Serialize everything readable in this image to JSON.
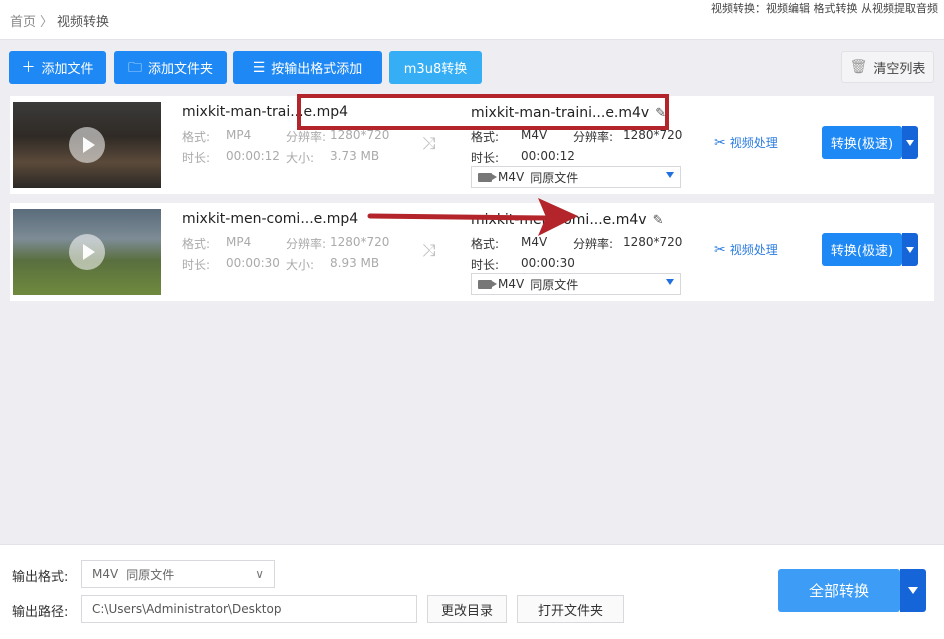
{
  "breadcrumb": {
    "home": "首页",
    "sep": "〉",
    "current": "视频转换"
  },
  "top_notice": "视频转换：视频编辑 格式转换 从视频提取音频",
  "toolbar": {
    "add_file": "添加文件",
    "add_folder": "添加文件夹",
    "add_by_format": "按输出格式添加",
    "m3u8": "m3u8转换",
    "clear_list": "清空列表"
  },
  "labels": {
    "format": "格式:",
    "resolution": "分辨率:",
    "duration": "时长:",
    "size": "大小:",
    "video_process": "视频处理",
    "convert_fast": "转换(极速)",
    "output_same_folder": "同原文件"
  },
  "files": [
    {
      "src_name": "mixkit-man-trai...e.mp4",
      "src_format": "MP4",
      "src_resolution": "1280*720",
      "src_duration": "00:00:12",
      "src_size": "3.73 MB",
      "dst_name": "mixkit-man-traini...e.m4v",
      "dst_format": "M4V",
      "dst_resolution": "1280*720",
      "dst_duration": "00:00:12",
      "dst_select": "M4V"
    },
    {
      "src_name": "mixkit-men-comi...e.mp4",
      "src_format": "MP4",
      "src_resolution": "1280*720",
      "src_duration": "00:00:30",
      "src_size": "8.93 MB",
      "dst_name": "mixkit-men-comi...e.m4v",
      "dst_format": "M4V",
      "dst_resolution": "1280*720",
      "dst_duration": "00:00:30",
      "dst_select": "M4V"
    }
  ],
  "bottom": {
    "output_format_label": "输出格式:",
    "output_format_value": "M4V",
    "output_format_folder": "同原文件",
    "output_path_label": "输出路径:",
    "output_path_value": "C:\\Users\\Administrator\\Desktop",
    "change_dir": "更改目录",
    "open_folder": "打开文件夹",
    "convert_all": "全部转换"
  },
  "colors": {
    "primary": "#1e88f5",
    "light": "#35aef5",
    "annotation": "#b3252a"
  }
}
